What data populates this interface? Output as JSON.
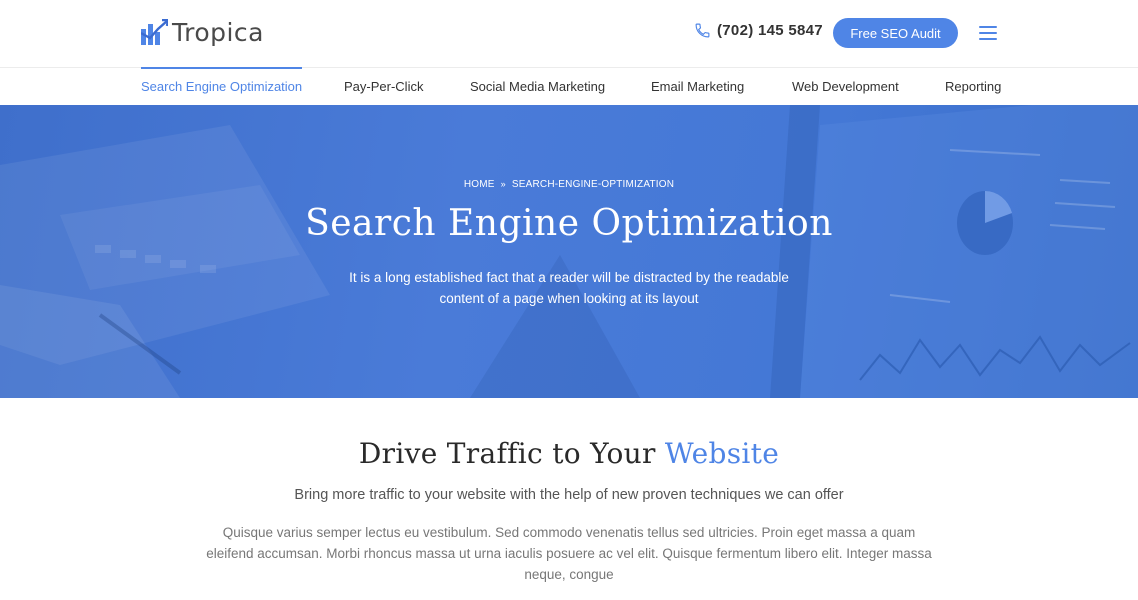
{
  "header": {
    "logo_text": "Tropica",
    "phone": "(702) 145 5847",
    "cta_label": "Free SEO Audit"
  },
  "nav": {
    "items": [
      {
        "label": "Search Engine Optimization",
        "active": true
      },
      {
        "label": "Pay-Per-Click"
      },
      {
        "label": "Social Media Marketing"
      },
      {
        "label": "Email Marketing"
      },
      {
        "label": "Web Development"
      },
      {
        "label": "Reporting"
      }
    ]
  },
  "hero": {
    "breadcrumb": {
      "home": "HOME",
      "current": "SEARCH-ENGINE-OPTIMIZATION"
    },
    "title": "Search Engine Optimization",
    "subtitle": "It is a long established fact that a reader will be distracted by the readable content of a page when looking at its layout"
  },
  "content": {
    "title_main": "Drive Traffic to Your",
    "title_accent": "Website",
    "lead": "Bring more traffic to your website with the help of new proven techniques we can offer",
    "body": "Quisque varius semper lectus eu vestibulum. Sed commodo venenatis tellus sed ultricies. Proin eget massa a quam eleifend accumsan. Morbi rhoncus massa ut urna iaculis posuere ac vel elit. Quisque fermentum libero elit. Integer massa neque, congue"
  },
  "colors": {
    "accent": "#4f85e6",
    "hero_bg": "#4a7bd8"
  },
  "icons": {
    "logo": "bar-chart-logo-icon",
    "phone": "phone-icon",
    "menu": "hamburger-menu-icon",
    "breadcrumb_separator": "double-chevron-right-icon"
  }
}
